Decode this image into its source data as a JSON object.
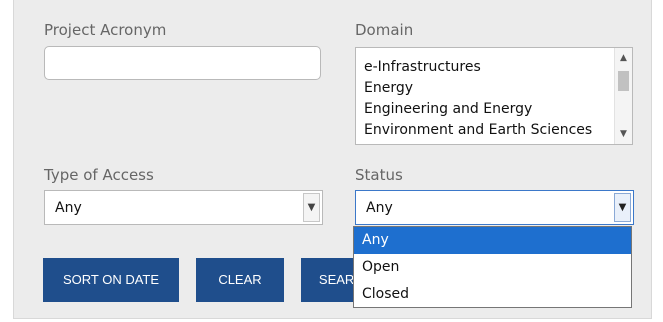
{
  "fields": {
    "acronym": {
      "label": "Project Acronym",
      "value": ""
    },
    "domain": {
      "label": "Domain",
      "options": [
        "e-Infrastructures",
        "Energy",
        "Engineering and Energy",
        "Environment and Earth Sciences"
      ]
    },
    "access": {
      "label": "Type of Access",
      "value": "Any"
    },
    "status": {
      "label": "Status",
      "value": "Any",
      "options": [
        "Any",
        "Open",
        "Closed"
      ]
    }
  },
  "buttons": {
    "sort": "SORT ON DATE",
    "clear": "CLEAR",
    "search": "SEARCH"
  },
  "icons": {
    "scroll_up": "▲",
    "scroll_down": "▼",
    "dropdown": "▼"
  },
  "colors": {
    "button": "#1f4e8c",
    "selected_option": "#1e6fcf",
    "panel": "#ececec"
  }
}
